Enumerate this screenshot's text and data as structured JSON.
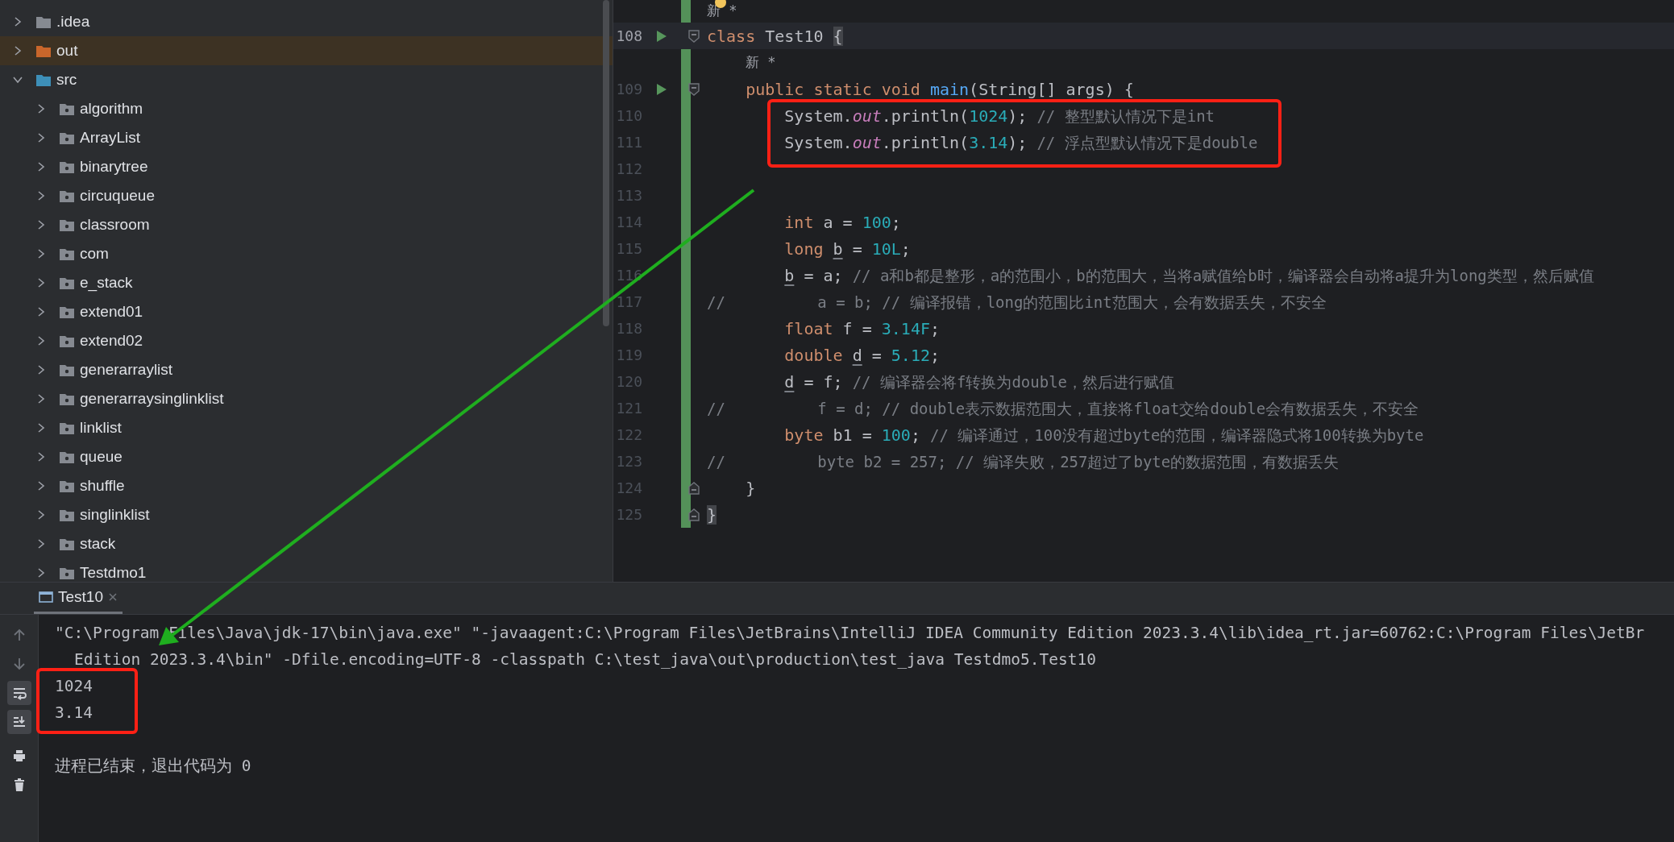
{
  "project_tree": [
    {
      "label": ".idea",
      "kind": "folder",
      "expanded": false
    },
    {
      "label": "out",
      "kind": "excluded",
      "expanded": false
    },
    {
      "label": "src",
      "kind": "source_root",
      "expanded": true,
      "children": [
        {
          "label": "algorithm",
          "kind": "package",
          "expanded": false
        },
        {
          "label": "ArrayList",
          "kind": "package",
          "expanded": false
        },
        {
          "label": "binarytree",
          "kind": "package",
          "expanded": false
        },
        {
          "label": "circuqueue",
          "kind": "package",
          "expanded": false
        },
        {
          "label": "classroom",
          "kind": "package",
          "expanded": false
        },
        {
          "label": "com",
          "kind": "package",
          "expanded": false
        },
        {
          "label": "e_stack",
          "kind": "package",
          "expanded": false
        },
        {
          "label": "extend01",
          "kind": "package",
          "expanded": false
        },
        {
          "label": "extend02",
          "kind": "package",
          "expanded": false
        },
        {
          "label": "generarraylist",
          "kind": "package",
          "expanded": false
        },
        {
          "label": "generarraysinglinklist",
          "kind": "package",
          "expanded": false
        },
        {
          "label": "linklist",
          "kind": "package",
          "expanded": false
        },
        {
          "label": "queue",
          "kind": "package",
          "expanded": false
        },
        {
          "label": "shuffle",
          "kind": "package",
          "expanded": false
        },
        {
          "label": "singlinklist",
          "kind": "package",
          "expanded": false
        },
        {
          "label": "stack",
          "kind": "package",
          "expanded": false
        },
        {
          "label": "Testdmo1",
          "kind": "package",
          "expanded": false
        }
      ]
    }
  ],
  "editor": {
    "rows": [
      {
        "kind": "hint",
        "text": "新 *"
      },
      {
        "kind": "code",
        "number": "108",
        "run": true,
        "fold_start": true,
        "fold_end": false,
        "current": true,
        "tokens": [
          {
            "kind": "keyword",
            "text": "class"
          },
          {
            "kind": "plain",
            "text": " Test10 "
          },
          {
            "kind": "brace",
            "text": "{"
          }
        ],
        "children": [
          {
            "kind": "hint",
            "text": "新 *"
          },
          {
            "kind": "code",
            "number": "109",
            "run": true,
            "fold_start": true,
            "fold_end": false,
            "current": false,
            "tokens": [
              {
                "kind": "keyword",
                "text": "public static void "
              },
              {
                "kind": "method",
                "text": "main"
              },
              {
                "kind": "plain",
                "text": "(String[] args) {"
              }
            ],
            "children": [
              {
                "kind": "code",
                "number": "110",
                "run": false,
                "fold_start": false,
                "fold_end": false,
                "current": false,
                "tokens": [
                  {
                    "kind": "plain",
                    "text": "System."
                  },
                  {
                    "kind": "static",
                    "text": "out"
                  },
                  {
                    "kind": "plain",
                    "text": ".println("
                  },
                  {
                    "kind": "number",
                    "text": "1024"
                  },
                  {
                    "kind": "plain",
                    "text": "); "
                  },
                  {
                    "kind": "comment",
                    "text": "// 整型默认情况下是int"
                  }
                ]
              },
              {
                "kind": "code",
                "number": "111",
                "run": false,
                "fold_start": false,
                "fold_end": false,
                "current": false,
                "tokens": [
                  {
                    "kind": "plain",
                    "text": "System."
                  },
                  {
                    "kind": "static",
                    "text": "out"
                  },
                  {
                    "kind": "plain",
                    "text": ".println("
                  },
                  {
                    "kind": "number",
                    "text": "3.14"
                  },
                  {
                    "kind": "plain",
                    "text": "); "
                  },
                  {
                    "kind": "comment",
                    "text": "// 浮点型默认情况下是double"
                  }
                ]
              },
              {
                "kind": "code",
                "number": "112",
                "run": false,
                "fold_start": false,
                "fold_end": false,
                "current": false
              },
              {
                "kind": "code",
                "number": "113",
                "run": false,
                "fold_start": false,
                "fold_end": false,
                "current": false
              },
              {
                "kind": "code",
                "number": "114",
                "run": false,
                "fold_start": false,
                "fold_end": false,
                "current": false,
                "tokens": [
                  {
                    "kind": "keyword",
                    "text": "int"
                  },
                  {
                    "kind": "plain",
                    "text": " a = "
                  },
                  {
                    "kind": "number",
                    "text": "100"
                  },
                  {
                    "kind": "plain",
                    "text": ";"
                  }
                ]
              },
              {
                "kind": "code",
                "number": "115",
                "run": false,
                "fold_start": false,
                "fold_end": false,
                "current": false,
                "tokens": [
                  {
                    "kind": "keyword",
                    "text": "long "
                  },
                  {
                    "kind": "variable",
                    "text": "b"
                  },
                  {
                    "kind": "plain",
                    "text": " = "
                  },
                  {
                    "kind": "number",
                    "text": "10L"
                  },
                  {
                    "kind": "plain",
                    "text": ";"
                  }
                ]
              },
              {
                "kind": "code",
                "number": "116",
                "run": false,
                "fold_start": false,
                "fold_end": false,
                "current": false,
                "tokens": [
                  {
                    "kind": "variable",
                    "text": "b"
                  },
                  {
                    "kind": "plain",
                    "text": " = a; "
                  },
                  {
                    "kind": "comment",
                    "text": "// a和b都是整形，a的范围小，b的范围大，当将a赋值给b时，编译器会自动将a提升为long类型，然后赋值"
                  }
                ]
              },
              {
                "kind": "commented",
                "number": "117",
                "run": false,
                "fold_start": false,
                "fold_end": false,
                "current": false,
                "tokens": [
                  {
                    "kind": "comment",
                    "text": "//          a = b; // 编译报错，long的范围比int范围大，会有数据丢失，不安全"
                  }
                ]
              },
              {
                "kind": "code",
                "number": "118",
                "run": false,
                "fold_start": false,
                "fold_end": false,
                "current": false,
                "tokens": [
                  {
                    "kind": "keyword",
                    "text": "float"
                  },
                  {
                    "kind": "plain",
                    "text": " f = "
                  },
                  {
                    "kind": "number",
                    "text": "3.14F"
                  },
                  {
                    "kind": "plain",
                    "text": ";"
                  }
                ]
              },
              {
                "kind": "code",
                "number": "119",
                "run": false,
                "fold_start": false,
                "fold_end": false,
                "current": false,
                "tokens": [
                  {
                    "kind": "keyword",
                    "text": "double "
                  },
                  {
                    "kind": "variable",
                    "text": "d"
                  },
                  {
                    "kind": "plain",
                    "text": " = "
                  },
                  {
                    "kind": "number",
                    "text": "5.12"
                  },
                  {
                    "kind": "plain",
                    "text": ";"
                  }
                ]
              },
              {
                "kind": "code",
                "number": "120",
                "run": false,
                "fold_start": false,
                "fold_end": false,
                "current": false,
                "tokens": [
                  {
                    "kind": "variable",
                    "text": "d"
                  },
                  {
                    "kind": "plain",
                    "text": " = f; "
                  },
                  {
                    "kind": "comment",
                    "text": "// 编译器会将f转换为double，然后进行赋值"
                  }
                ]
              },
              {
                "kind": "commented",
                "number": "121",
                "run": false,
                "fold_start": false,
                "fold_end": false,
                "current": false,
                "tokens": [
                  {
                    "kind": "comment",
                    "text": "//          f = d; // double表示数据范围大，直接将float交给double会有数据丢失，不安全"
                  }
                ]
              },
              {
                "kind": "code",
                "number": "122",
                "run": false,
                "fold_start": false,
                "fold_end": false,
                "current": false,
                "tokens": [
                  {
                    "kind": "keyword",
                    "text": "byte"
                  },
                  {
                    "kind": "plain",
                    "text": " b1 = "
                  },
                  {
                    "kind": "number",
                    "text": "100"
                  },
                  {
                    "kind": "plain",
                    "text": "; "
                  },
                  {
                    "kind": "comment",
                    "text": "// 编译通过，100没有超过byte的范围，编译器隐式将100转换为byte"
                  }
                ]
              },
              {
                "kind": "commented",
                "number": "123",
                "run": false,
                "fold_start": false,
                "fold_end": false,
                "current": false,
                "tokens": [
                  {
                    "kind": "comment",
                    "text": "//          byte b2 = 257; // 编译失败，257超过了byte的数据范围，有数据丢失"
                  }
                ]
              }
            ]
          },
          {
            "kind": "code",
            "number": "124",
            "run": false,
            "fold_start": false,
            "fold_end": true,
            "current": false,
            "tokens": [
              {
                "kind": "plain",
                "text": "}"
              }
            ]
          }
        ]
      },
      {
        "kind": "code",
        "number": "125",
        "run": false,
        "fold_start": false,
        "fold_end": true,
        "current": false,
        "tokens": [
          {
            "kind": "brace",
            "text": "}"
          }
        ]
      }
    ]
  },
  "run_panel": {
    "tabs": [
      {
        "label": "Test10",
        "selected": true
      }
    ],
    "toolbar": [
      {
        "kind": "up",
        "on": false
      },
      {
        "kind": "down",
        "on": false
      },
      {
        "kind": "wrap",
        "on": true
      },
      {
        "kind": "scroll_end",
        "on": true
      },
      {
        "kind": "print",
        "on": false
      },
      {
        "kind": "trash",
        "on": false
      }
    ],
    "console": [
      {
        "kind": "command",
        "text": "\"C:\\Program Files\\Java\\jdk-17\\bin\\java.exe\" \"-javaagent:C:\\Program Files\\JetBrains\\IntelliJ IDEA Community Edition 2023.3.4\\lib\\idea_rt.jar=60762:C:\\Program Files\\JetBr"
      },
      {
        "kind": "wrap",
        "text": "Edition 2023.3.4\\bin\" -Dfile.encoding=UTF-8 -classpath C:\\test_java\\out\\production\\test_java Testdmo5.Test10"
      },
      {
        "kind": "output",
        "text": "1024"
      },
      {
        "kind": "output",
        "text": "3.14"
      },
      {
        "kind": "exit",
        "text": "进程已结束，退出代码为 0"
      }
    ]
  }
}
